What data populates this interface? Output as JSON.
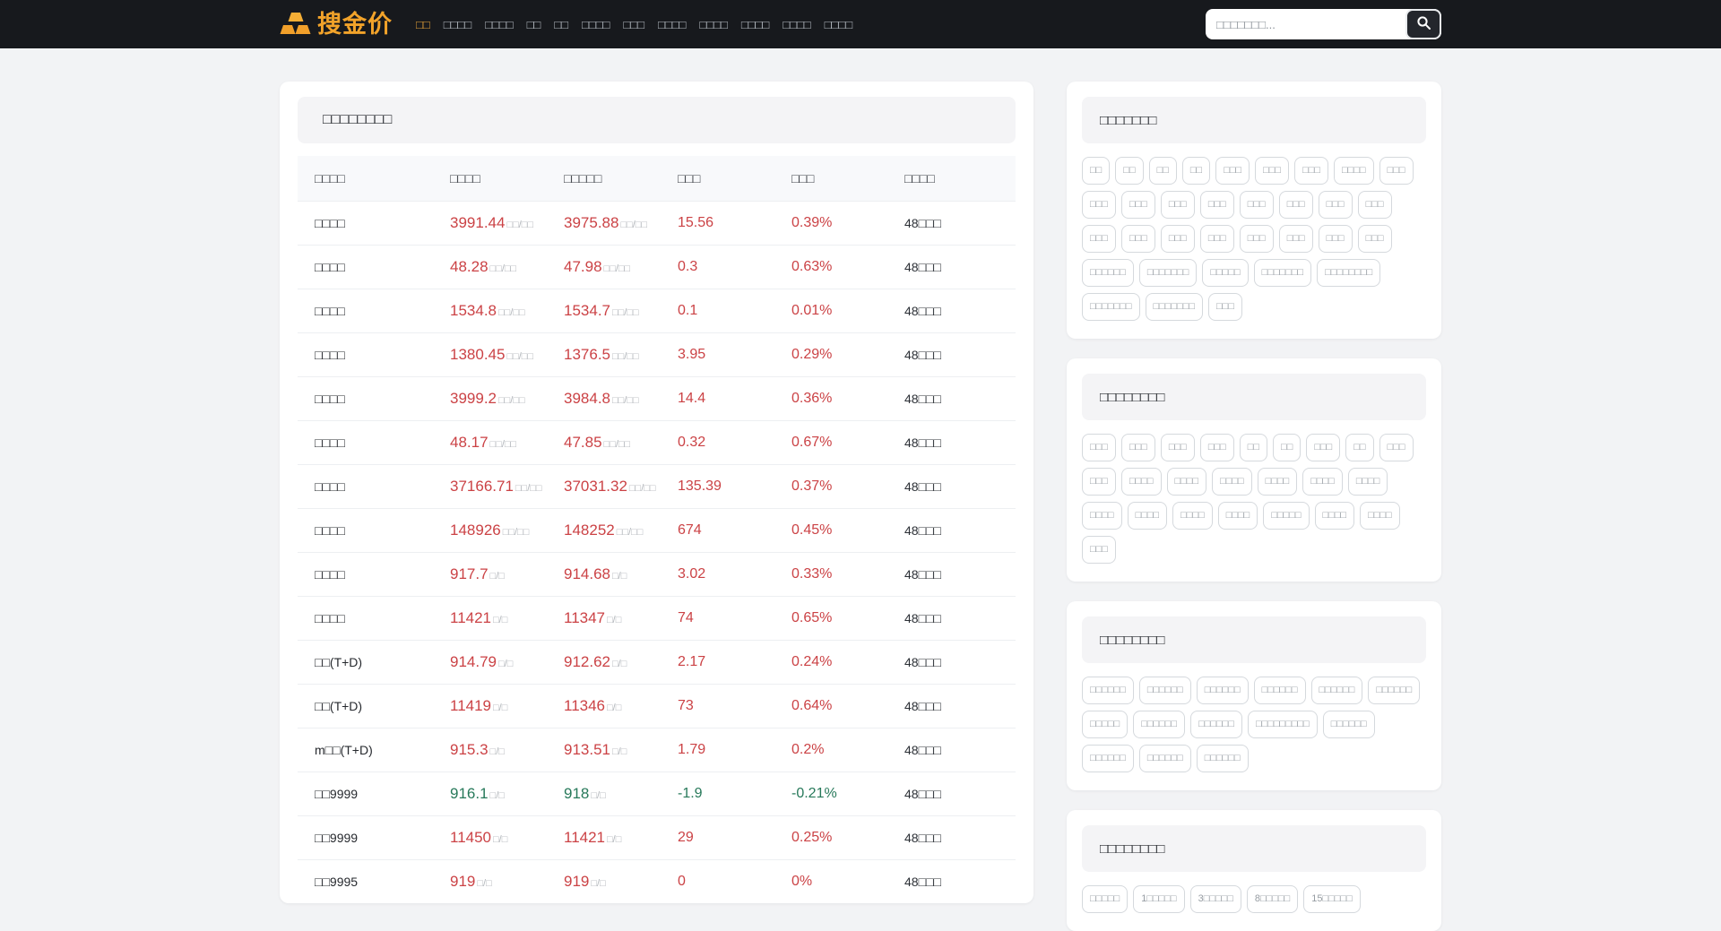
{
  "header": {
    "logo_text": "搜金价",
    "logo_icon": "gold-bars-icon",
    "nav_items": [
      {
        "label": "□□",
        "active": true
      },
      {
        "label": "□□□□",
        "active": false
      },
      {
        "label": "□□□□",
        "active": false
      },
      {
        "label": "□□",
        "active": false
      },
      {
        "label": "□□",
        "active": false
      },
      {
        "label": "□□□□",
        "active": false
      },
      {
        "label": "□□□",
        "active": false
      },
      {
        "label": "□□□□",
        "active": false
      },
      {
        "label": "□□□□",
        "active": false
      },
      {
        "label": "□□□□",
        "active": false
      },
      {
        "label": "□□□□",
        "active": false
      },
      {
        "label": "□□□□",
        "active": false
      }
    ],
    "search": {
      "placeholder": "□□□□□□□...",
      "button_icon": "search-icon"
    }
  },
  "main_table": {
    "title": "□□□□□□□□",
    "columns": [
      "□□□□",
      "□□□□",
      "□□□□□",
      "□□□",
      "□□□",
      "□□□□"
    ],
    "rows": [
      {
        "name": "□□□□",
        "price": "3991.44",
        "price_unit": "□□/□□",
        "prev": "3975.88",
        "prev_unit": "□□/□□",
        "change": "15.56",
        "pct": "0.39%",
        "updated": "48□□□",
        "trend": "up"
      },
      {
        "name": "□□□□",
        "price": "48.28",
        "price_unit": "□□/□□",
        "prev": "47.98",
        "prev_unit": "□□/□□",
        "change": "0.3",
        "pct": "0.63%",
        "updated": "48□□□",
        "trend": "up"
      },
      {
        "name": "□□□□",
        "price": "1534.8",
        "price_unit": "□□/□□",
        "prev": "1534.7",
        "prev_unit": "□□/□□",
        "change": "0.1",
        "pct": "0.01%",
        "updated": "48□□□",
        "trend": "up"
      },
      {
        "name": "□□□□",
        "price": "1380.45",
        "price_unit": "□□/□□",
        "prev": "1376.5",
        "prev_unit": "□□/□□",
        "change": "3.95",
        "pct": "0.29%",
        "updated": "48□□□",
        "trend": "up"
      },
      {
        "name": "□□□□",
        "price": "3999.2",
        "price_unit": "□□/□□",
        "prev": "3984.8",
        "prev_unit": "□□/□□",
        "change": "14.4",
        "pct": "0.36%",
        "updated": "48□□□",
        "trend": "up"
      },
      {
        "name": "□□□□",
        "price": "48.17",
        "price_unit": "□□/□□",
        "prev": "47.85",
        "prev_unit": "□□/□□",
        "change": "0.32",
        "pct": "0.67%",
        "updated": "48□□□",
        "trend": "up"
      },
      {
        "name": "□□□□",
        "price": "37166.71",
        "price_unit": "□□/□□",
        "prev": "37031.32",
        "prev_unit": "□□/□□",
        "change": "135.39",
        "pct": "0.37%",
        "updated": "48□□□",
        "trend": "up"
      },
      {
        "name": "□□□□",
        "price": "148926",
        "price_unit": "□□/□□",
        "prev": "148252",
        "prev_unit": "□□/□□",
        "change": "674",
        "pct": "0.45%",
        "updated": "48□□□",
        "trend": "up"
      },
      {
        "name": "□□□□",
        "price": "917.7",
        "price_unit": "□/□",
        "prev": "914.68",
        "prev_unit": "□/□",
        "change": "3.02",
        "pct": "0.33%",
        "updated": "48□□□",
        "trend": "up"
      },
      {
        "name": "□□□□",
        "price": "11421",
        "price_unit": "□/□",
        "prev": "11347",
        "prev_unit": "□/□",
        "change": "74",
        "pct": "0.65%",
        "updated": "48□□□",
        "trend": "up"
      },
      {
        "name": "□□(T+D)",
        "price": "914.79",
        "price_unit": "□/□",
        "prev": "912.62",
        "prev_unit": "□/□",
        "change": "2.17",
        "pct": "0.24%",
        "updated": "48□□□",
        "trend": "up"
      },
      {
        "name": "□□(T+D)",
        "price": "11419",
        "price_unit": "□/□",
        "prev": "11346",
        "prev_unit": "□/□",
        "change": "73",
        "pct": "0.64%",
        "updated": "48□□□",
        "trend": "up"
      },
      {
        "name": "m□□(T+D)",
        "price": "915.3",
        "price_unit": "□/□",
        "prev": "913.51",
        "prev_unit": "□/□",
        "change": "1.79",
        "pct": "0.2%",
        "updated": "48□□□",
        "trend": "up"
      },
      {
        "name": "□□9999",
        "price": "916.1",
        "price_unit": "□/□",
        "prev": "918",
        "prev_unit": "□/□",
        "change": "-1.9",
        "pct": "-0.21%",
        "updated": "48□□□",
        "trend": "down"
      },
      {
        "name": "□□9999",
        "price": "11450",
        "price_unit": "□/□",
        "prev": "11421",
        "prev_unit": "□/□",
        "change": "29",
        "pct": "0.25%",
        "updated": "48□□□",
        "trend": "up"
      },
      {
        "name": "□□9995",
        "price": "919",
        "price_unit": "□/□",
        "prev": "919",
        "prev_unit": "□/□",
        "change": "0",
        "pct": "0%",
        "updated": "48□□□",
        "trend": "up"
      }
    ]
  },
  "sidebar_sections": [
    {
      "title": "□□□□□□□",
      "tags": [
        "□□",
        "□□",
        "□□",
        "□□",
        "□□□",
        "□□□",
        "□□□",
        "□□□□",
        "□□□",
        "□□□",
        "□□□",
        "□□□",
        "□□□",
        "□□□",
        "□□□",
        "□□□",
        "□□□",
        "□□□",
        "□□□",
        "□□□",
        "□□□",
        "□□□",
        "□□□",
        "□□□",
        "□□□",
        "□□□□□□",
        "□□□□□□□",
        "□□□□□",
        "□□□□□□□",
        "□□□□□□□□",
        "□□□□□□□",
        "□□□□□□□",
        "□□□"
      ]
    },
    {
      "title": "□□□□□□□□",
      "tags": [
        "□□□",
        "□□□",
        "□□□",
        "□□□",
        "□□",
        "□□",
        "□□□",
        "□□",
        "□□□",
        "□□□",
        "□□□□",
        "□□□□",
        "□□□□",
        "□□□□",
        "□□□□",
        "□□□□",
        "□□□□",
        "□□□□",
        "□□□□",
        "□□□□",
        "□□□□□",
        "□□□□",
        "□□□□",
        "□□□"
      ]
    },
    {
      "title": "□□□□□□□□",
      "tags": [
        "□□□□□□",
        "□□□□□□",
        "□□□□□□",
        "□□□□□□",
        "□□□□□□",
        "□□□□□□",
        "□□□□□",
        "□□□□□□",
        "□□□□□□",
        "□□□□□□□□□",
        "□□□□□□",
        "□□□□□□",
        "□□□□□□",
        "□□□□□□"
      ]
    },
    {
      "title": "□□□□□□□□",
      "tags": [
        "□□□□□",
        "1□□□□□",
        "3□□□□□",
        "8□□□□□",
        "15□□□□□"
      ]
    }
  ],
  "colors": {
    "accent": "#f2a32a",
    "up": "#cb4245",
    "down": "#27795a",
    "header_bg": "#17191d"
  }
}
